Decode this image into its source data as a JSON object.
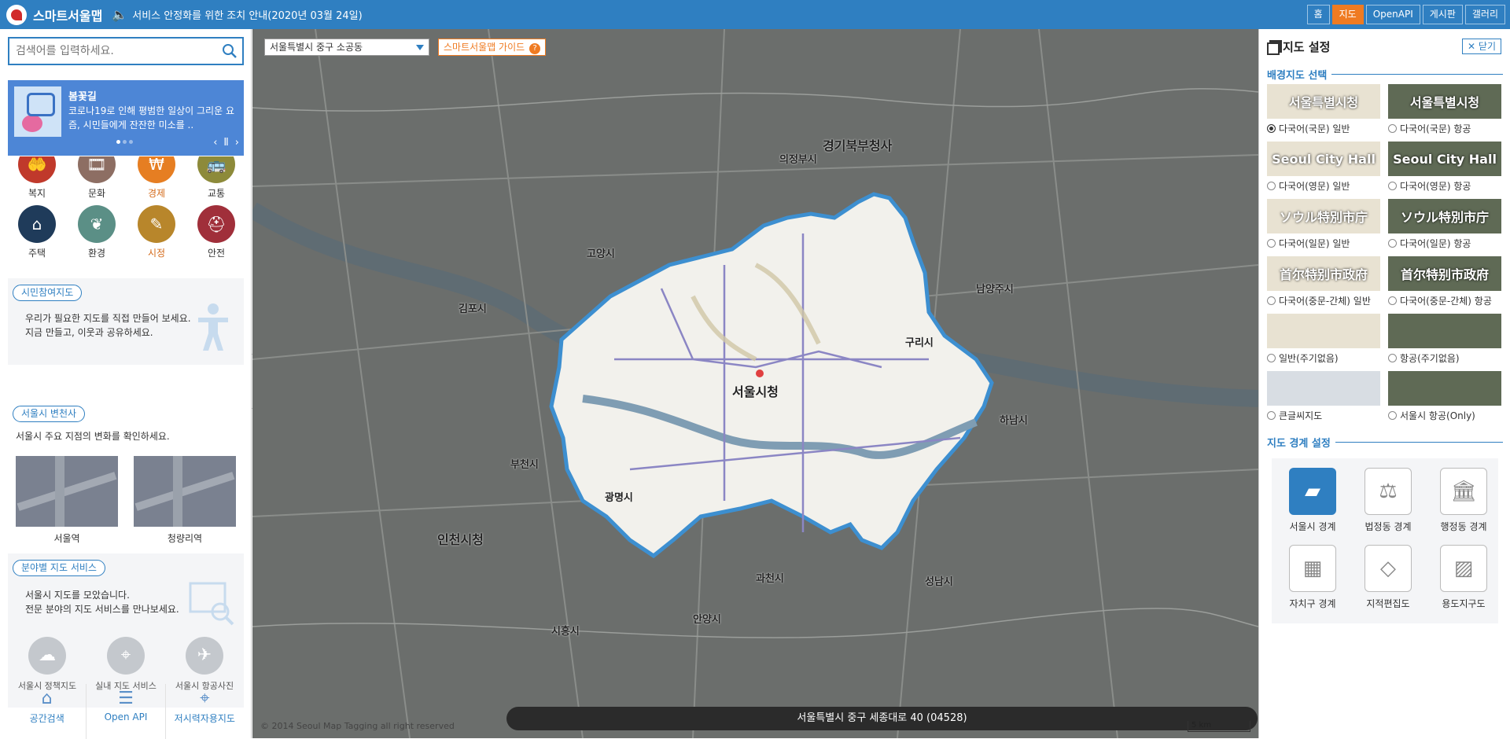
{
  "app": {
    "title": "스마트서울맵",
    "notice": "서비스 안정화를 위한 조치 안내(2020년 03월 24일)"
  },
  "topnav": [
    {
      "label": "홈",
      "active": false
    },
    {
      "label": "지도",
      "active": true
    },
    {
      "label": "OpenAPI",
      "active": false
    },
    {
      "label": "게시판",
      "active": false
    },
    {
      "label": "갤러리",
      "active": false
    }
  ],
  "search": {
    "placeholder": "검색어를 입력하세요."
  },
  "banner": {
    "title": "봄꽃길",
    "desc": "코로나19로 인해 평범한 일상이 그리운 요즘, 시민들에게 잔잔한 미소를 ..",
    "prev": "‹",
    "pause": "Ⅱ",
    "next": "›"
  },
  "categories": [
    {
      "label": "복지",
      "color": "#c0392b",
      "icon": "🤲"
    },
    {
      "label": "문화",
      "color": "#8d6e63",
      "icon": "🎞"
    },
    {
      "label": "경제",
      "color": "#e67e22",
      "icon": "₩"
    },
    {
      "label": "교통",
      "color": "#8d8a3a",
      "icon": "🚌"
    },
    {
      "label": "주택",
      "color": "#1f3b5a",
      "icon": "⌂"
    },
    {
      "label": "환경",
      "color": "#5b8f86",
      "icon": "❦"
    },
    {
      "label": "시정",
      "color": "#b8862b",
      "icon": "✎"
    },
    {
      "label": "안전",
      "color": "#a02f3a",
      "icon": "⛑"
    }
  ],
  "citizen": {
    "title": "시민참여지도",
    "line1": "우리가 필요한 지도를 직접 만들어 보세요.",
    "line2": "지금 만들고, 이웃과 공유하세요."
  },
  "history": {
    "title": "서울시 변천사",
    "desc": "서울시 주요 지점의 변화를 확인하세요.",
    "items": [
      {
        "label": "서울역"
      },
      {
        "label": "청량리역"
      }
    ]
  },
  "field": {
    "title": "분야별 지도 서비스",
    "line1": "서울시 지도를 모았습니다.",
    "line2": "전문 분야의 지도 서비스를 만나보세요.",
    "items": [
      {
        "label": "서울시 정책지도"
      },
      {
        "label": "실내 지도 서비스"
      },
      {
        "label": "서울시 항공사진"
      }
    ]
  },
  "bottomnav": [
    {
      "label": "공간검색"
    },
    {
      "label": "Open API"
    },
    {
      "label": "저시력자용지도"
    }
  ],
  "map": {
    "address_select": "서울특별시 중구 소공동",
    "guide": "스마트서울맵 가이드",
    "guide_q": "?",
    "current_address": "서울특별시 중구 세종대로 40 (04528)",
    "copyright": "© 2014 Seoul Map Tagging all right reserved",
    "scale": "5 km",
    "labels": {
      "seoul_cityhall": "서울시청",
      "gyeonggi_north": "경기북부청사",
      "incheon_cityhall": "인천시청",
      "gimpo": "김포시",
      "goyang": "고양시",
      "guri": "구리시",
      "hanam": "하남시",
      "gwacheon": "과천시",
      "anyang": "안양시",
      "bucheon": "부천시",
      "gwangmyeong": "광명시",
      "siheung": "시흥시",
      "seongnam": "성남시",
      "uijeongbu": "의정부시",
      "namyangju": "남양주시"
    }
  },
  "settings": {
    "title": "지도 설정",
    "close": "닫기",
    "basemap_title": "배경지도 선택",
    "basemaps": [
      {
        "label": "다국어(국문) 일반",
        "thumb": "서울특별시청",
        "kind": "gen",
        "selected": true
      },
      {
        "label": "다국어(국문) 항공",
        "thumb": "서울특별시청",
        "kind": "air",
        "selected": false
      },
      {
        "label": "다국어(영문) 일반",
        "thumb": "Seoul City Hall",
        "kind": "gen",
        "selected": false
      },
      {
        "label": "다국어(영문) 항공",
        "thumb": "Seoul City Hall",
        "kind": "air",
        "selected": false
      },
      {
        "label": "다국어(일문) 일반",
        "thumb": "ソウル特別市庁",
        "kind": "gen",
        "selected": false
      },
      {
        "label": "다국어(일문) 항공",
        "thumb": "ソウル特別市庁",
        "kind": "air",
        "selected": false
      },
      {
        "label": "다국어(중문-간체) 일반",
        "thumb": "首尔特别市政府",
        "kind": "gen",
        "selected": false
      },
      {
        "label": "다국어(중문-간체) 항공",
        "thumb": "首尔特别市政府",
        "kind": "air",
        "selected": false
      },
      {
        "label": "일반(주기없음)",
        "thumb": "",
        "kind": "gen",
        "selected": false
      },
      {
        "label": "항공(주기없음)",
        "thumb": "",
        "kind": "air",
        "selected": false
      },
      {
        "label": "큰글씨지도",
        "thumb": "",
        "kind": "big",
        "selected": false
      },
      {
        "label": "서울시 항공(Only)",
        "thumb": "",
        "kind": "air",
        "selected": false
      }
    ],
    "boundary_title": "지도 경계 설정",
    "boundaries": [
      {
        "label": "서울시 경계",
        "icon": "▰",
        "selected": true
      },
      {
        "label": "법정동 경계",
        "icon": "⚖",
        "selected": false
      },
      {
        "label": "행정동 경계",
        "icon": "🏛",
        "selected": false
      },
      {
        "label": "자치구 경계",
        "icon": "▦",
        "selected": false
      },
      {
        "label": "지적편집도",
        "icon": "◇",
        "selected": false
      },
      {
        "label": "용도지구도",
        "icon": "▨",
        "selected": false
      }
    ]
  }
}
